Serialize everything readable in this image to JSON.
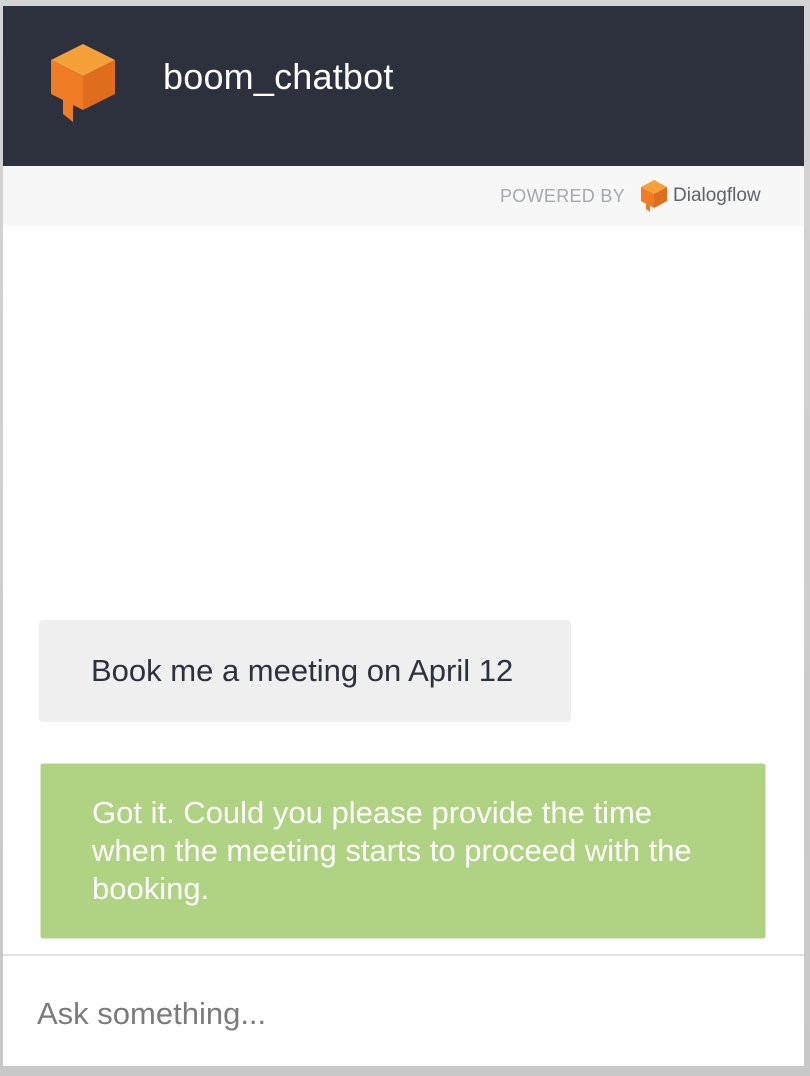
{
  "header": {
    "bot_name": "boom_chatbot",
    "logo_icon": "dialogflow-cube-speech-icon",
    "background_color": "#2d303d",
    "logo_color": "#ef7b24"
  },
  "powered_by": {
    "label": "POWERED BY",
    "brand": "Dialogflow",
    "brand_icon": "dialogflow-logo-icon"
  },
  "messages": [
    {
      "sender": "user",
      "text": "Book me a meeting on April 12",
      "bubble_color": "#efefef"
    },
    {
      "sender": "bot",
      "text": "Got it. Could you please provide the time when the meeting starts to proceed with the booking.",
      "bubble_color": "#b0d283"
    }
  ],
  "input": {
    "placeholder": "Ask something...",
    "value": ""
  }
}
